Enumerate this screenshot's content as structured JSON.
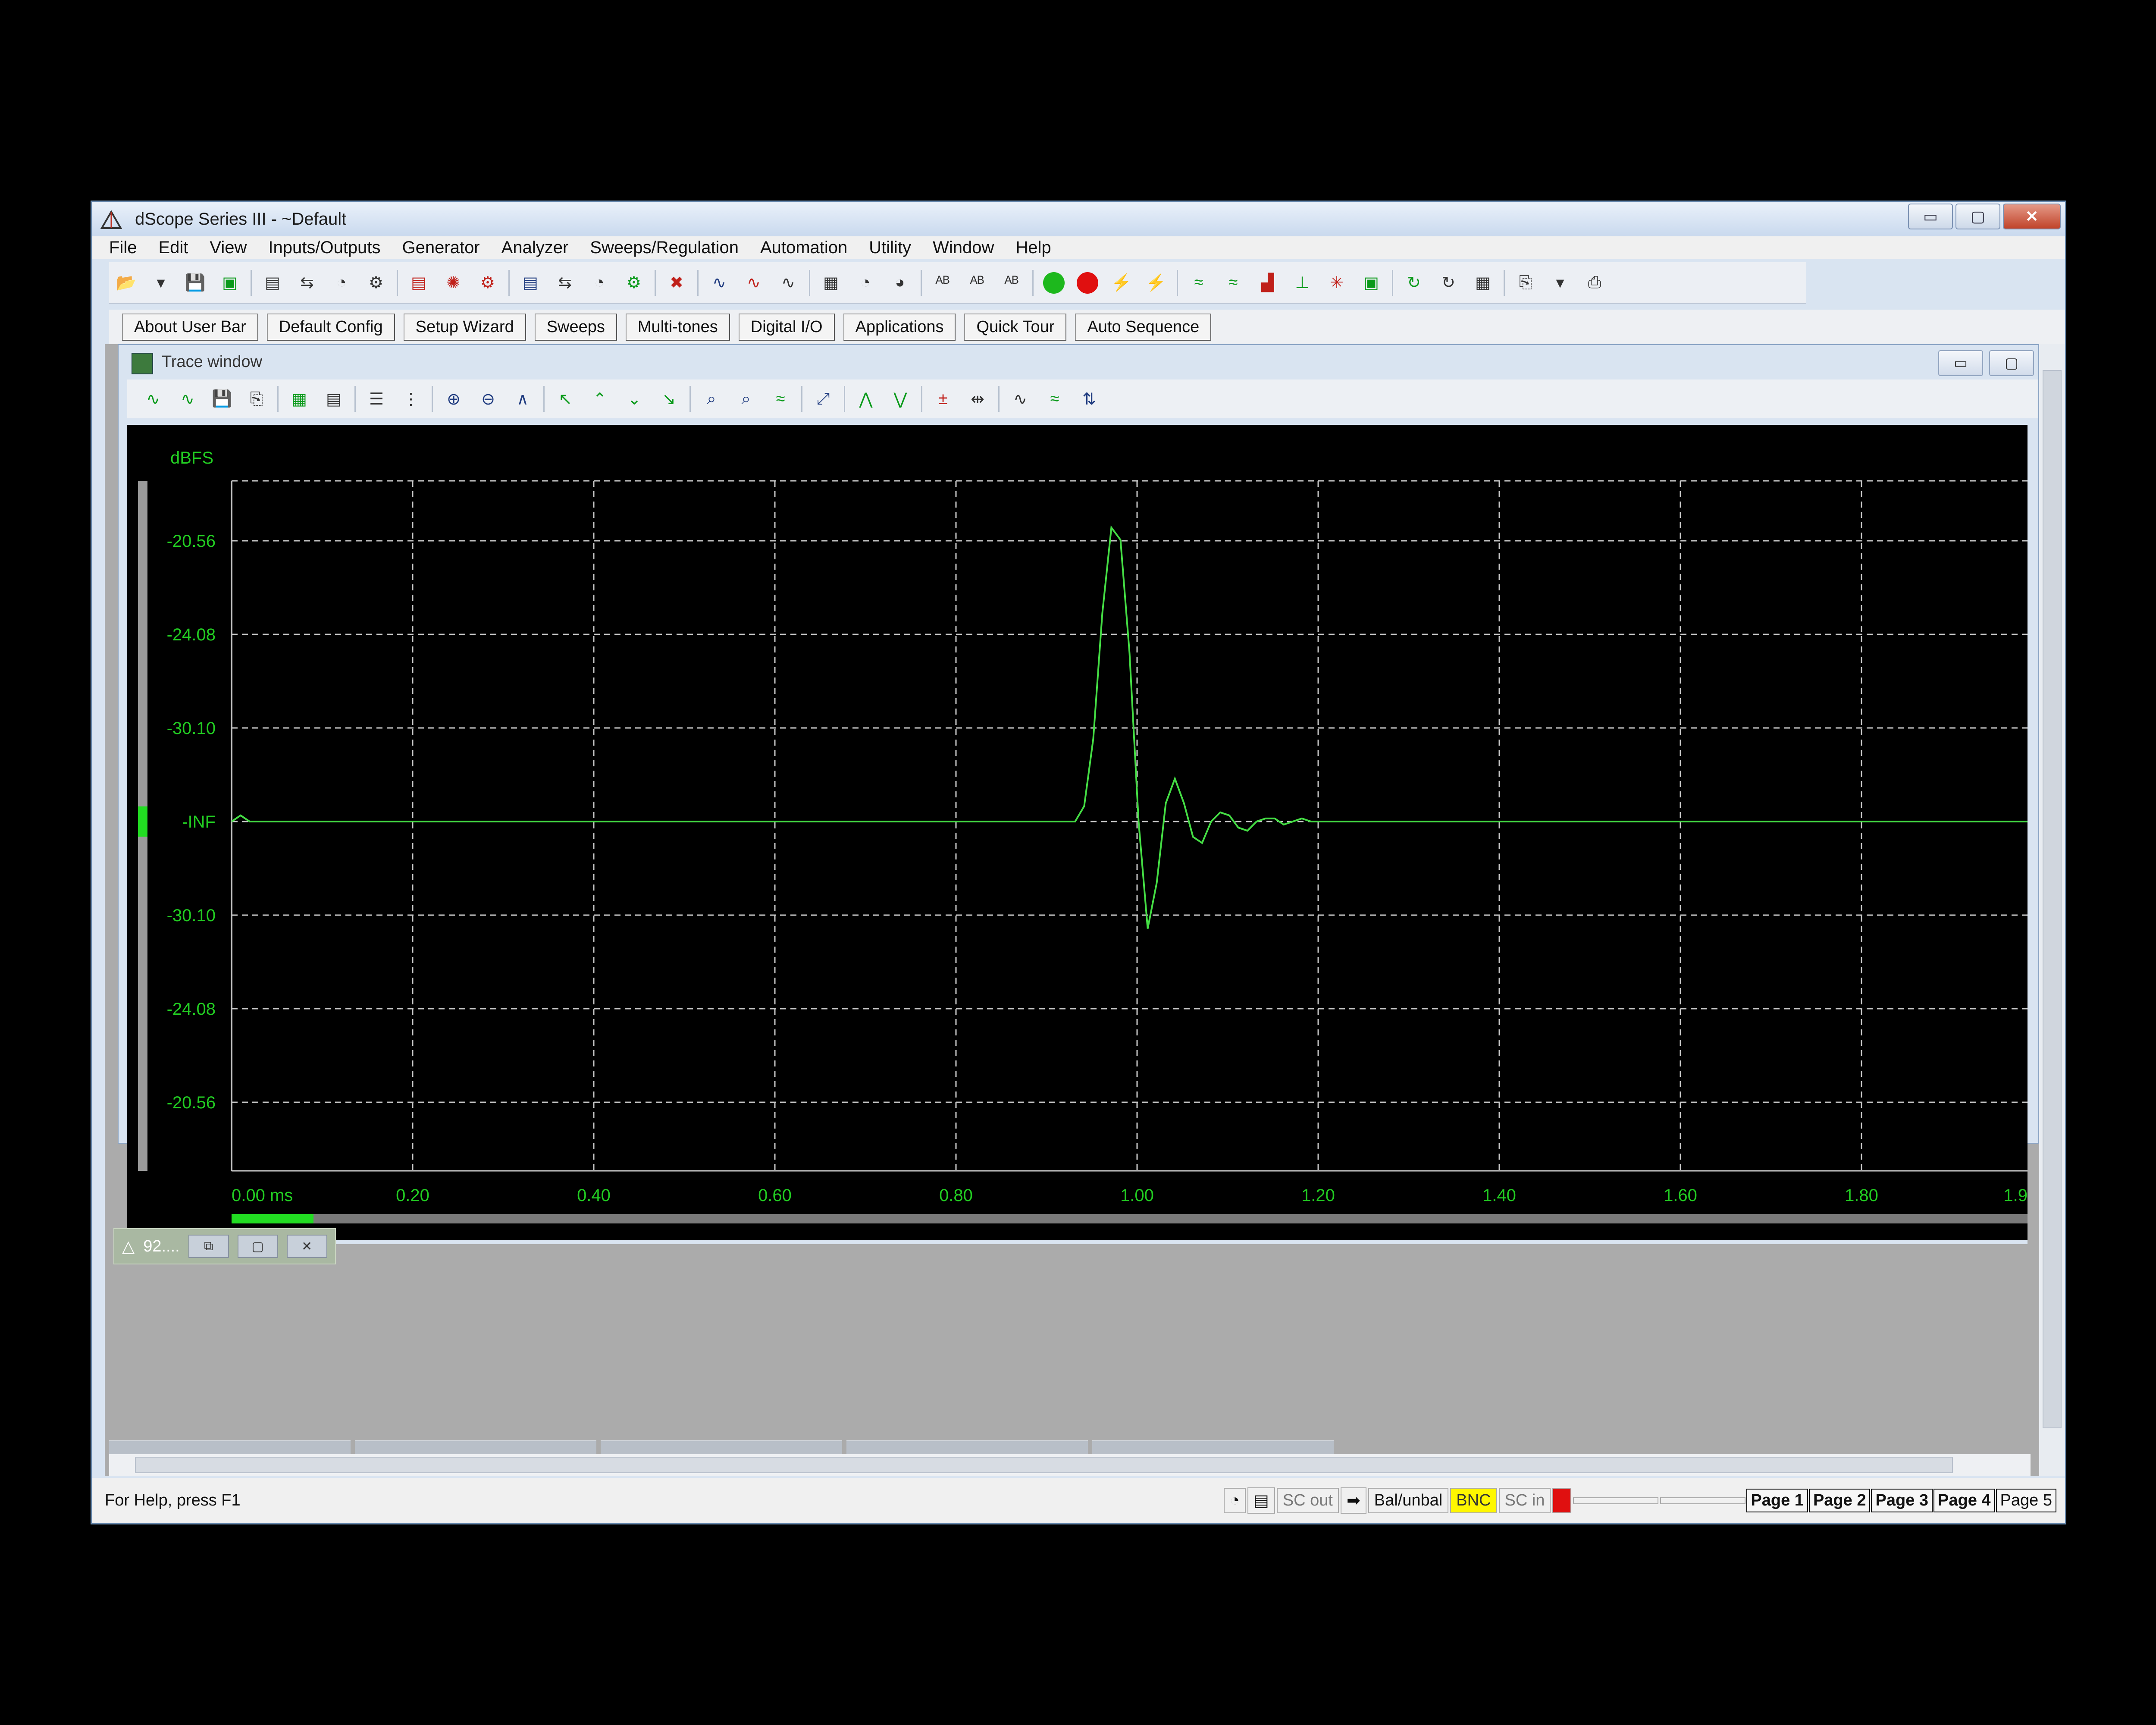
{
  "window": {
    "title": "dScope Series III - ~Default",
    "min": "▭",
    "max": "▢",
    "close": "✕"
  },
  "menu": [
    "File",
    "Edit",
    "View",
    "Inputs/Outputs",
    "Generator",
    "Analyzer",
    "Sweeps/Regulation",
    "Automation",
    "Utility",
    "Window",
    "Help"
  ],
  "user_bar": [
    "About User Bar",
    "Default Config",
    "Setup Wizard",
    "Sweeps",
    "Multi-tones",
    "Digital I/O",
    "Applications",
    "Quick Tour",
    "Auto Sequence"
  ],
  "trace_window": {
    "title": "Trace window",
    "min": "▭",
    "max": "▢"
  },
  "mini_window": {
    "title": "92....",
    "restore": "⧉",
    "max": "▢",
    "close": "✕"
  },
  "status": {
    "help": "For Help, press F1",
    "sc_out": "SC out",
    "arrow": "➡",
    "balunbal": "Bal/unbal",
    "bnc": "BNC",
    "sc_in": "SC in",
    "pages": [
      "Page 1",
      "Page 2",
      "Page 3",
      "Page 4",
      "Page 5"
    ]
  },
  "colors": {
    "trace": "#44dd44",
    "axis_text": "#22cc22",
    "grid": "#c8c8c8",
    "plot_bg": "#000000"
  },
  "chart_data": {
    "type": "line",
    "ylabel": "dBFS",
    "y_tick_labels": [
      "-20.56",
      "-24.08",
      "-30.10",
      "-INF",
      "-30.10",
      "-24.08",
      "-20.56"
    ],
    "x_tick_labels": [
      "0.00 ms",
      "0.20",
      "0.40",
      "0.60",
      "0.80",
      "1.00",
      "1.20",
      "1.40",
      "1.60",
      "1.80",
      "1.9"
    ],
    "xlim": [
      0,
      1.98
    ],
    "ylim": [
      -1,
      1
    ],
    "grid": true,
    "series": [
      {
        "x": [
          0.0,
          0.01,
          0.02,
          0.93,
          0.94,
          0.95,
          0.96,
          0.97,
          0.98,
          0.99,
          1.0,
          1.01,
          1.02,
          1.03,
          1.04,
          1.05,
          1.06,
          1.07,
          1.08,
          1.09,
          1.1,
          1.11,
          1.12,
          1.13,
          1.14,
          1.15,
          1.16,
          1.17,
          1.18,
          1.19,
          1.2,
          1.22,
          1.98
        ],
        "y": [
          0,
          0.02,
          0,
          0,
          0.05,
          0.27,
          0.68,
          0.96,
          0.92,
          0.55,
          0.0,
          -0.35,
          -0.2,
          0.06,
          0.14,
          0.06,
          -0.05,
          -0.07,
          0.0,
          0.03,
          0.02,
          -0.02,
          -0.03,
          0.0,
          0.01,
          0.01,
          -0.01,
          0,
          0.01,
          0.0,
          0.0,
          0,
          0
        ]
      }
    ]
  }
}
